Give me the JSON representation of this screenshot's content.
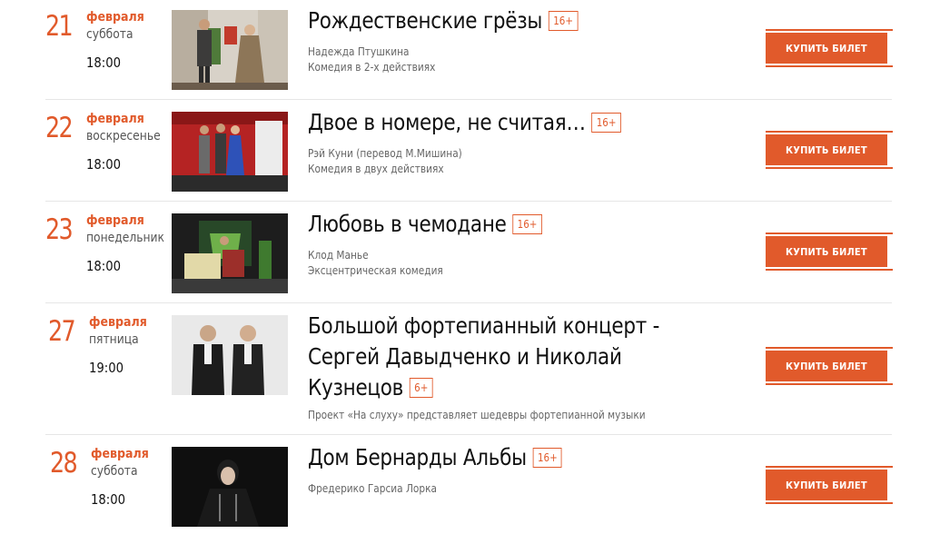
{
  "accent_color": "#e15a2b",
  "events": [
    {
      "day": "21",
      "month": "февраля",
      "weekday": "суббота",
      "time": "18:00",
      "title": "Рождественские грёзы",
      "age": "16+",
      "author": "Надежда Птушкина",
      "genre": "Комедия в 2-х действиях",
      "buy_label": "КУПИТЬ БИЛЕТ"
    },
    {
      "day": "22",
      "month": "февраля",
      "weekday": "воскресенье",
      "time": "18:00",
      "title": "Двое в номере, не считая…",
      "age": "16+",
      "author": "Рэй Куни (перевод М.Мишина)",
      "genre": "Комедия в двух действиях",
      "buy_label": "КУПИТЬ БИЛЕТ"
    },
    {
      "day": "23",
      "month": "февраля",
      "weekday": "понедельник",
      "time": "18:00",
      "title": "Любовь в чемодане",
      "age": "16+",
      "author": "Клод Манье",
      "genre": "Эксцентрическая комедия",
      "buy_label": "КУПИТЬ БИЛЕТ"
    },
    {
      "day": "27",
      "month": "февраля",
      "weekday": "пятница",
      "time": "19:00",
      "title": "Большой фортепианный концерт - Сергей Давыдченко и Николай Кузнецов",
      "age": "6+",
      "author": "Проект «На слуху» представляет шедевры фортепианной музыки",
      "buy_label": "КУПИТЬ БИЛЕТ"
    },
    {
      "day": "28",
      "month": "февраля",
      "weekday": "суббота",
      "time": "18:00",
      "title": "Дом Бернарды Альбы",
      "age": "16+",
      "author": "Фредерико Гарсиа Лорка",
      "buy_label": "КУПИТЬ БИЛЕТ"
    }
  ]
}
